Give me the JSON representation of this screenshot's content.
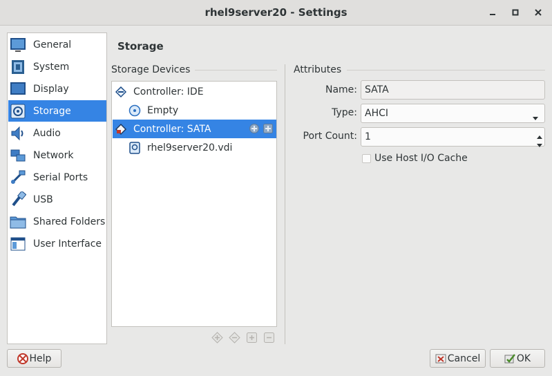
{
  "window": {
    "title": "rhel9server20 - Settings"
  },
  "sidebar": {
    "items": [
      {
        "label": "General",
        "icon": "general-icon"
      },
      {
        "label": "System",
        "icon": "system-icon"
      },
      {
        "label": "Display",
        "icon": "display-icon"
      },
      {
        "label": "Storage",
        "icon": "storage-icon",
        "selected": true
      },
      {
        "label": "Audio",
        "icon": "audio-icon"
      },
      {
        "label": "Network",
        "icon": "network-icon"
      },
      {
        "label": "Serial Ports",
        "icon": "serial-ports-icon"
      },
      {
        "label": "USB",
        "icon": "usb-icon"
      },
      {
        "label": "Shared Folders",
        "icon": "shared-folders-icon"
      },
      {
        "label": "User Interface",
        "icon": "user-interface-icon"
      }
    ]
  },
  "page": {
    "title": "Storage"
  },
  "storage_devices": {
    "label": "Storage Devices",
    "tree": [
      {
        "label": "Controller: IDE",
        "type": "controller"
      },
      {
        "label": "Empty",
        "type": "optical"
      },
      {
        "label": "Controller: SATA",
        "type": "controller",
        "selected": true
      },
      {
        "label": "rhel9server20.vdi",
        "type": "disk"
      }
    ]
  },
  "attributes": {
    "label": "Attributes",
    "name_label": "Name:",
    "name_value": "SATA",
    "type_label": "Type:",
    "type_value": "AHCI",
    "port_count_label": "Port Count:",
    "port_count_value": "1",
    "host_io_cache_label": "Use Host I/O Cache",
    "host_io_cache_checked": false
  },
  "buttons": {
    "help": "Help",
    "cancel": "Cancel",
    "ok": "OK"
  },
  "colors": {
    "accent": "#3584e4",
    "background": "#e8e8e7"
  }
}
